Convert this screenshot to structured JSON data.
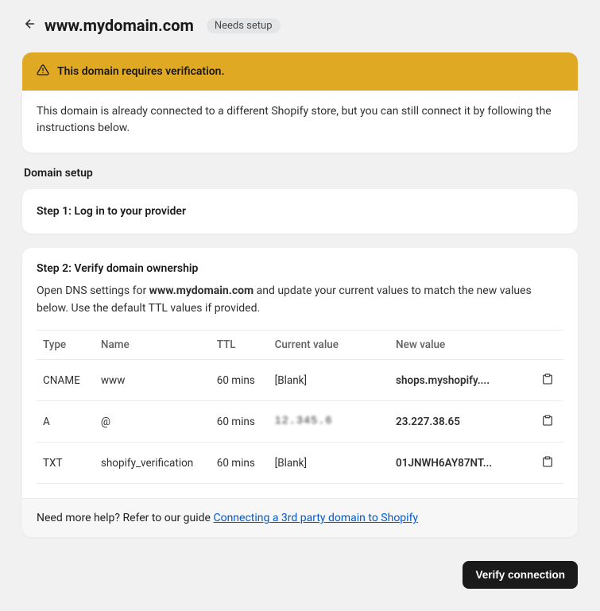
{
  "header": {
    "title": "www.mydomain.com",
    "badge": "Needs setup"
  },
  "alert": {
    "title": "This domain requires verification.",
    "body": "This domain is already connected to a different Shopify store, but you can still connect it by following the instructions below."
  },
  "sectionLabel": "Domain setup",
  "step1": {
    "title": "Step 1: Log in to your provider"
  },
  "step2": {
    "title": "Step 2: Verify domain ownership",
    "desc_prefix": "Open DNS settings for ",
    "desc_domain": "www.mydomain.com",
    "desc_suffix": " and update your current values to match the new values below. Use the default TTL values if provided."
  },
  "table": {
    "headers": {
      "type": "Type",
      "name": "Name",
      "ttl": "TTL",
      "current": "Current value",
      "newv": "New value"
    },
    "rows": [
      {
        "type": "CNAME",
        "name": "www",
        "ttl": "60 mins",
        "current": "[Blank]",
        "current_blurred": false,
        "newv": "shops.myshopify...."
      },
      {
        "type": "A",
        "name": "@",
        "ttl": "60 mins",
        "current": "12.345.6",
        "current_blurred": true,
        "newv": "23.227.38.65"
      },
      {
        "type": "TXT",
        "name": "shopify_verification",
        "ttl": "60 mins",
        "current": "[Blank]",
        "current_blurred": false,
        "newv": "01JNWH6AY87NT..."
      }
    ]
  },
  "help": {
    "prefix": "Need more help? Refer to our guide ",
    "link": "Connecting a 3rd party domain to Shopify"
  },
  "footer": {
    "verify": "Verify connection"
  }
}
